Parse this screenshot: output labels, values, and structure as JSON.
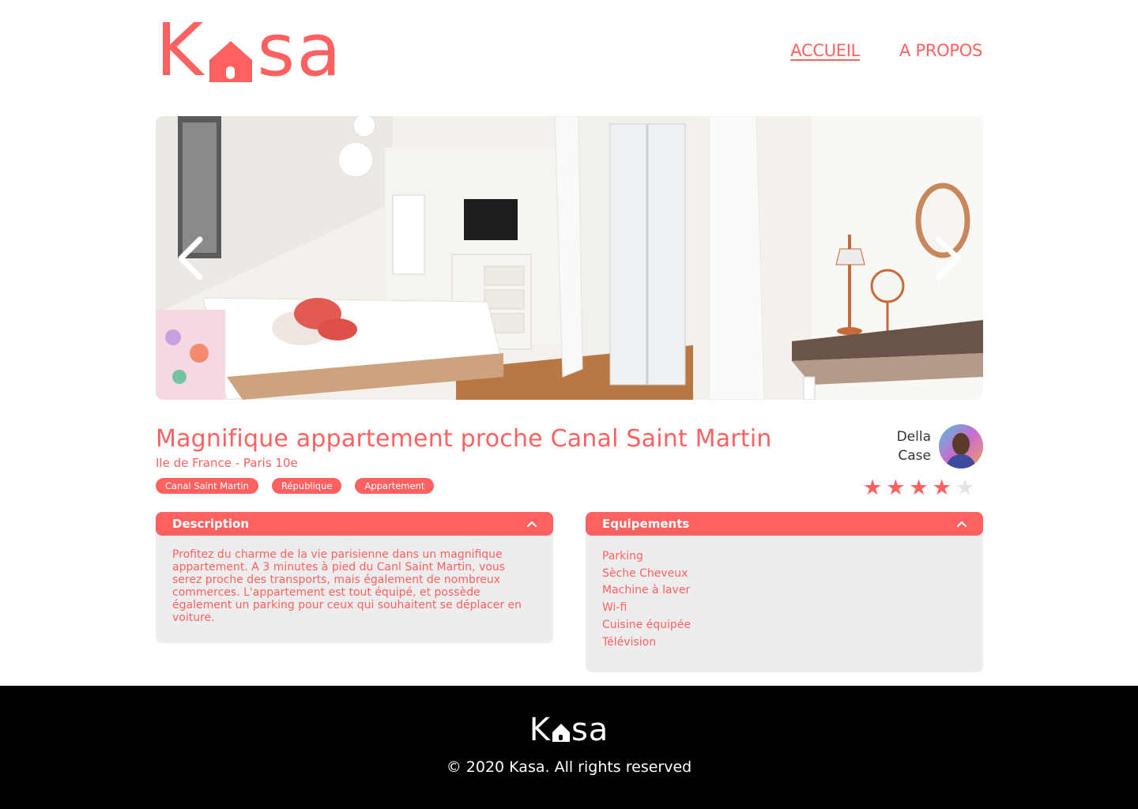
{
  "header": {
    "logo_part1": "K",
    "logo_part2": "sa",
    "nav": [
      {
        "label": "ACCUEIL",
        "active": true
      },
      {
        "label": "A PROPOS",
        "active": false
      }
    ]
  },
  "gallery": {
    "prev_icon": "chevron-left-icon",
    "next_icon": "chevron-right-icon"
  },
  "listing": {
    "title": "Magnifique appartement proche Canal Saint Martin",
    "location": "Ile de France - Paris 10e",
    "tags": [
      "Canal Saint Martin",
      "République",
      "Appartement"
    ],
    "host": {
      "name": "Della Case"
    },
    "rating": {
      "value": 4,
      "max": 5
    }
  },
  "description": {
    "title": "Description",
    "text": "Profitez du charme de la vie parisienne dans un magnifique appartement. A 3 minutes à pied du Canl Saint Martin, vous serez proche des transports, mais également de nombreux commerces. L'appartement est tout équipé, et possède également un parking pour ceux qui souhaitent se déplacer en voiture."
  },
  "equipements": {
    "title": "Equipements",
    "items": [
      "Parking",
      "Sèche Cheveux",
      "Machine à laver",
      "Wi-fi",
      "Cuisine équipée",
      "Télévision"
    ]
  },
  "footer": {
    "logo_part1": "K",
    "logo_part2": "sa",
    "copyright": "© 2020 Kasa. All rights reserved"
  },
  "colors": {
    "accent": "#FF6060",
    "panel": "#EDEDED",
    "footer": "#000000"
  }
}
